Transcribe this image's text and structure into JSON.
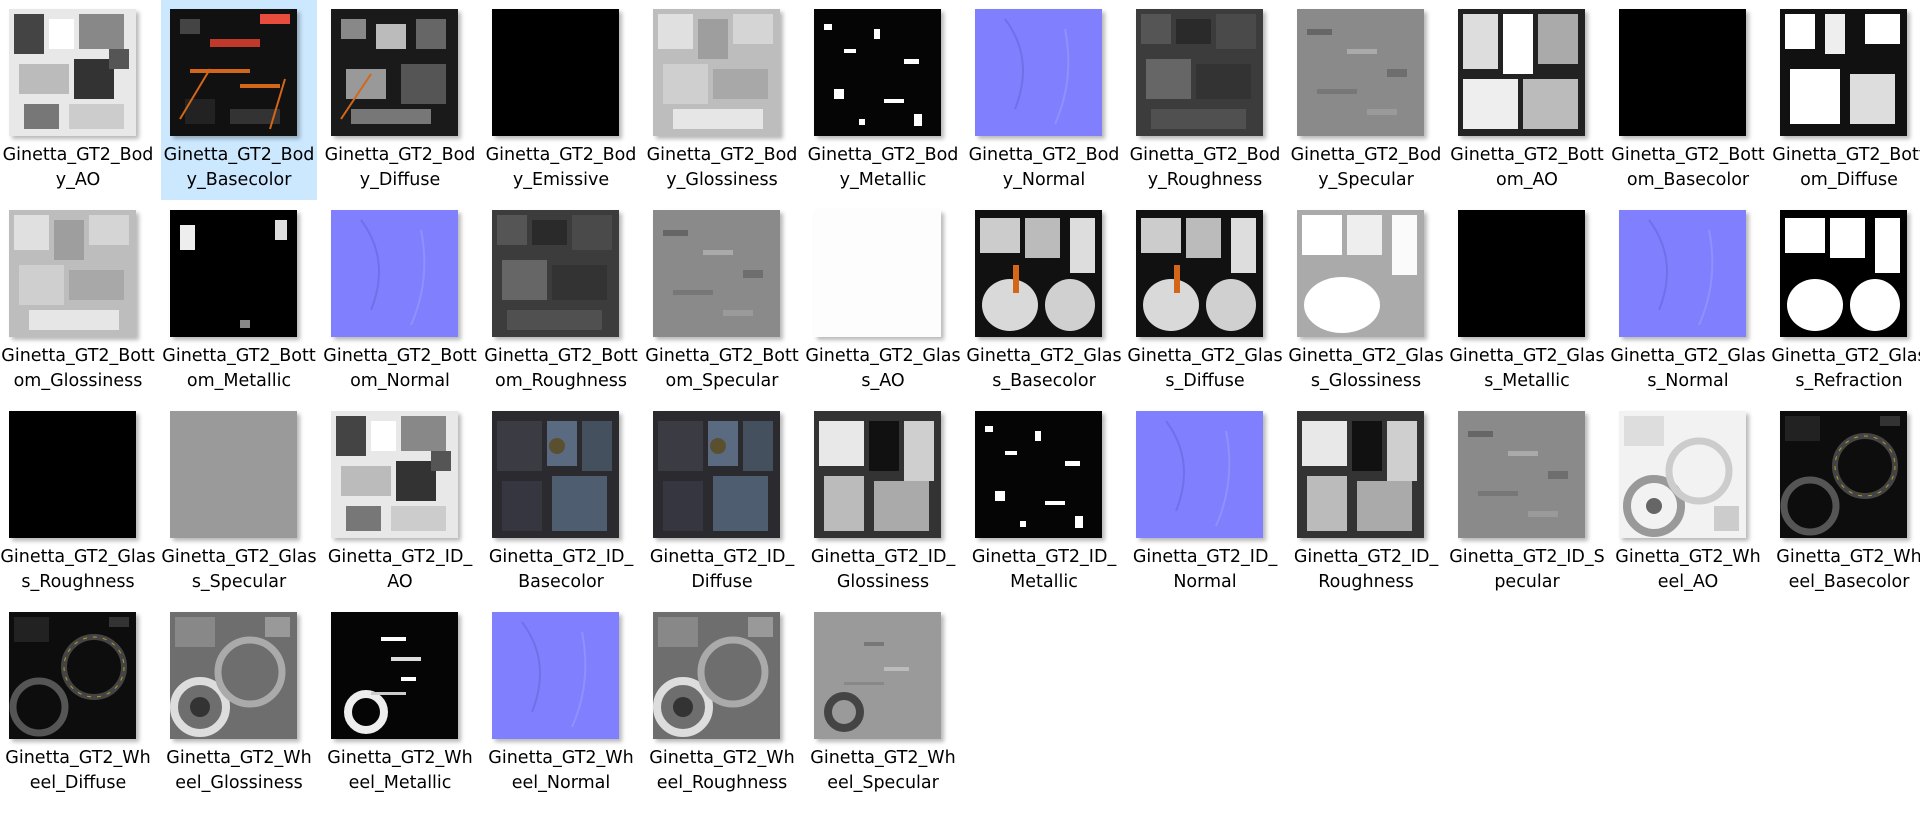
{
  "view": "large-icons",
  "selected_index": 1,
  "files": [
    {
      "name": "Ginetta_GT2_Body_AO",
      "theme": "ao"
    },
    {
      "name": "Ginetta_GT2_Body_Basecolor",
      "theme": "basecolor"
    },
    {
      "name": "Ginetta_GT2_Body_Diffuse",
      "theme": "diffuse"
    },
    {
      "name": "Ginetta_GT2_Body_Emissive",
      "theme": "black"
    },
    {
      "name": "Ginetta_GT2_Body_Glossiness",
      "theme": "light-gray"
    },
    {
      "name": "Ginetta_GT2_Body_Metallic",
      "theme": "metallic"
    },
    {
      "name": "Ginetta_GT2_Body_Normal",
      "theme": "normal"
    },
    {
      "name": "Ginetta_GT2_Body_Roughness",
      "theme": "dark-gray"
    },
    {
      "name": "Ginetta_GT2_Body_Specular",
      "theme": "mid-gray"
    },
    {
      "name": "Ginetta_GT2_Bottom_AO",
      "theme": "ao-bottom"
    },
    {
      "name": "Ginetta_GT2_Bottom_Basecolor",
      "theme": "black"
    },
    {
      "name": "Ginetta_GT2_Bottom_Diffuse",
      "theme": "bw-shapes"
    },
    {
      "name": "Ginetta_GT2_Bottom_Glossiness",
      "theme": "light-gray"
    },
    {
      "name": "Ginetta_GT2_Bottom_Metallic",
      "theme": "black-spots"
    },
    {
      "name": "Ginetta_GT2_Bottom_Normal",
      "theme": "normal"
    },
    {
      "name": "Ginetta_GT2_Bottom_Roughness",
      "theme": "dark-gray"
    },
    {
      "name": "Ginetta_GT2_Bottom_Specular",
      "theme": "mid-gray"
    },
    {
      "name": "Ginetta_GT2_Glass_AO",
      "theme": "white"
    },
    {
      "name": "Ginetta_GT2_Glass_Basecolor",
      "theme": "glass-shapes"
    },
    {
      "name": "Ginetta_GT2_Glass_Diffuse",
      "theme": "glass-shapes"
    },
    {
      "name": "Ginetta_GT2_Glass_Glossiness",
      "theme": "glass-light"
    },
    {
      "name": "Ginetta_GT2_Glass_Metallic",
      "theme": "black"
    },
    {
      "name": "Ginetta_GT2_Glass_Normal",
      "theme": "normal"
    },
    {
      "name": "Ginetta_GT2_Glass_Refraction",
      "theme": "glass-bw"
    },
    {
      "name": "Ginetta_GT2_Glass_Roughness",
      "theme": "black"
    },
    {
      "name": "Ginetta_GT2_Glass_Specular",
      "theme": "flat-gray"
    },
    {
      "name": "Ginetta_GT2_ID_AO",
      "theme": "ao"
    },
    {
      "name": "Ginetta_GT2_ID_Basecolor",
      "theme": "id-dark"
    },
    {
      "name": "Ginetta_GT2_ID_Diffuse",
      "theme": "id-dark"
    },
    {
      "name": "Ginetta_GT2_ID_Glossiness",
      "theme": "id-gloss"
    },
    {
      "name": "Ginetta_GT2_ID_Metallic",
      "theme": "metallic"
    },
    {
      "name": "Ginetta_GT2_ID_Normal",
      "theme": "normal"
    },
    {
      "name": "Ginetta_GT2_ID_Roughness",
      "theme": "id-gloss"
    },
    {
      "name": "Ginetta_GT2_ID_Specular",
      "theme": "mid-gray"
    },
    {
      "name": "Ginetta_GT2_Wheel_AO",
      "theme": "wheel-light"
    },
    {
      "name": "Ginetta_GT2_Wheel_Basecolor",
      "theme": "wheel-dark"
    },
    {
      "name": "Ginetta_GT2_Wheel_Diffuse",
      "theme": "wheel-dark"
    },
    {
      "name": "Ginetta_GT2_Wheel_Glossiness",
      "theme": "wheel-gray"
    },
    {
      "name": "Ginetta_GT2_Wheel_Metallic",
      "theme": "wheel-metal"
    },
    {
      "name": "Ginetta_GT2_Wheel_Normal",
      "theme": "normal"
    },
    {
      "name": "Ginetta_GT2_Wheel_Roughness",
      "theme": "wheel-gray"
    },
    {
      "name": "Ginetta_GT2_Wheel_Specular",
      "theme": "wheel-spec"
    }
  ],
  "colors": {
    "selection": "#cce8ff",
    "normal_map": "#8080ff",
    "orange_accent": "#d4661a"
  }
}
